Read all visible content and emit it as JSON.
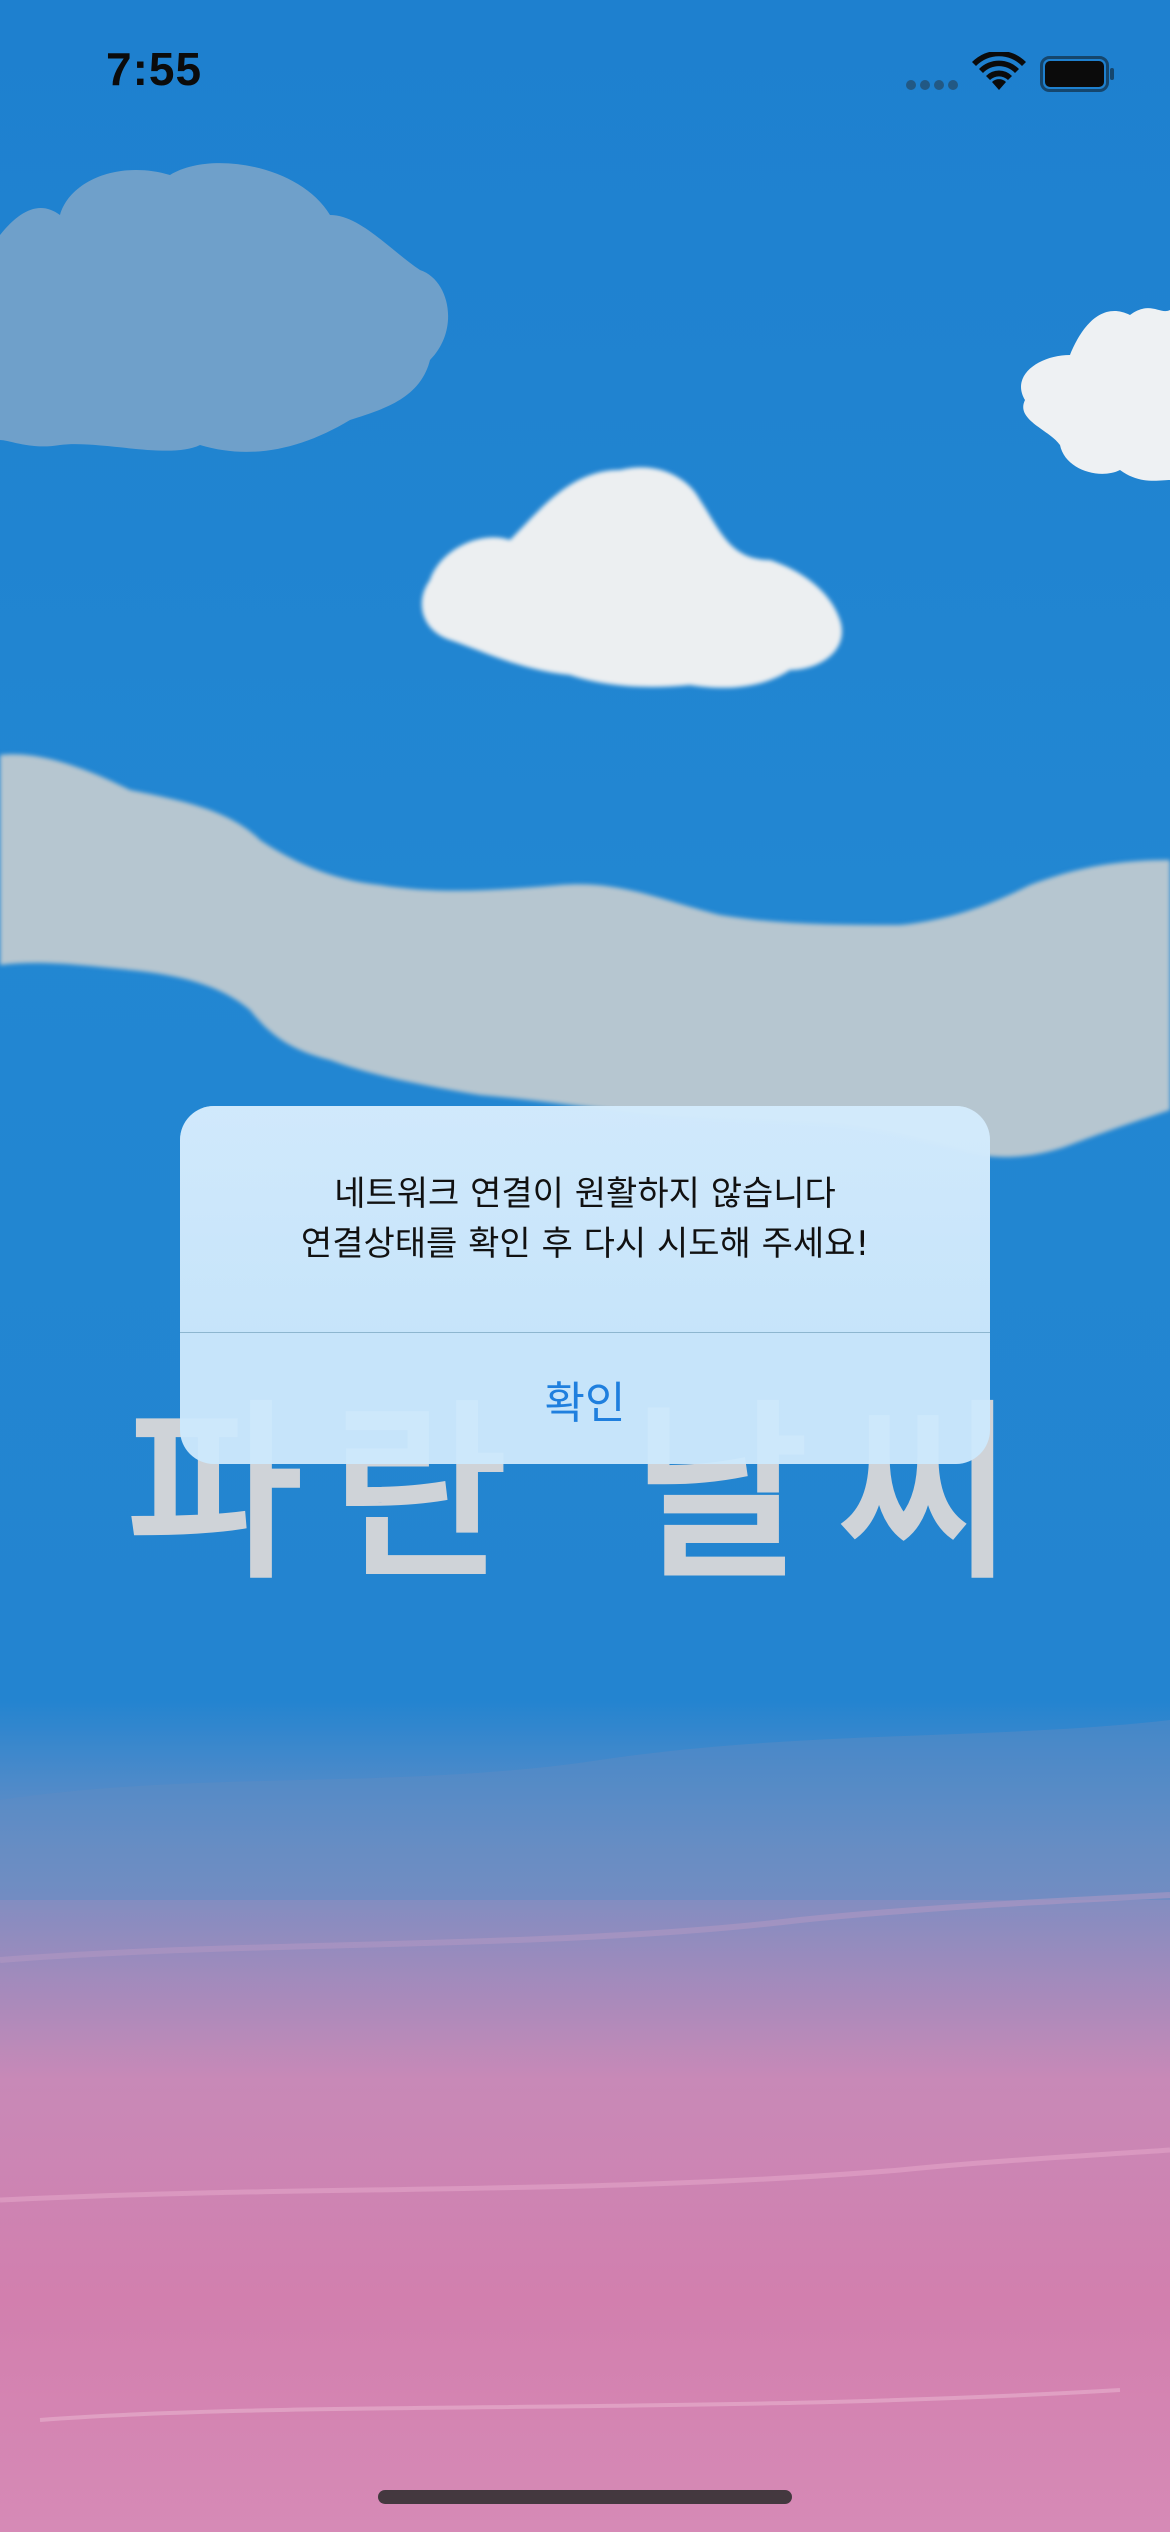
{
  "status_bar": {
    "time": "7:55",
    "wifi_icon": "wifi-icon",
    "battery_icon": "battery-icon",
    "signal_icon": "cellular-dots-icon"
  },
  "app": {
    "title": "파란 날씨"
  },
  "alert": {
    "message_line_1": "네트워크 연결이 원활하지 않습니다",
    "message_line_2": "연결상태를 확인 후 다시 시도해 주세요!",
    "confirm_label": "확인"
  },
  "colors": {
    "sky": "#1f80cf",
    "cloud": "#e9eef0",
    "ground_pink": "#d27fae",
    "alert_bg": "#cde8fc",
    "accent": "#1f7fde",
    "title": "#cfd3d8"
  }
}
